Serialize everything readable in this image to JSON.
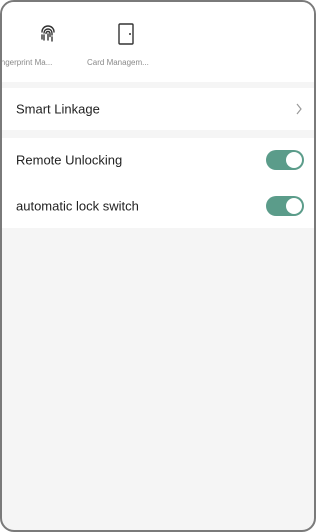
{
  "quick_actions": [
    {
      "label": "ingerprint Ma...",
      "icon": "fingerprint-icon"
    },
    {
      "label": "Card Managem...",
      "icon": "door-card-icon"
    }
  ],
  "settings": {
    "smart_linkage": {
      "label": "Smart Linkage",
      "icon": "chevron-right-icon"
    },
    "remote_unlocking": {
      "label": "Remote Unlocking",
      "enabled": true
    },
    "automatic_lock_switch": {
      "label": "automatic lock switch",
      "enabled": true
    }
  },
  "colors": {
    "toggle_on": "#5b9c8a",
    "background": "#f5f5f5",
    "card": "#ffffff",
    "secondary_text": "#8a8a8a"
  }
}
